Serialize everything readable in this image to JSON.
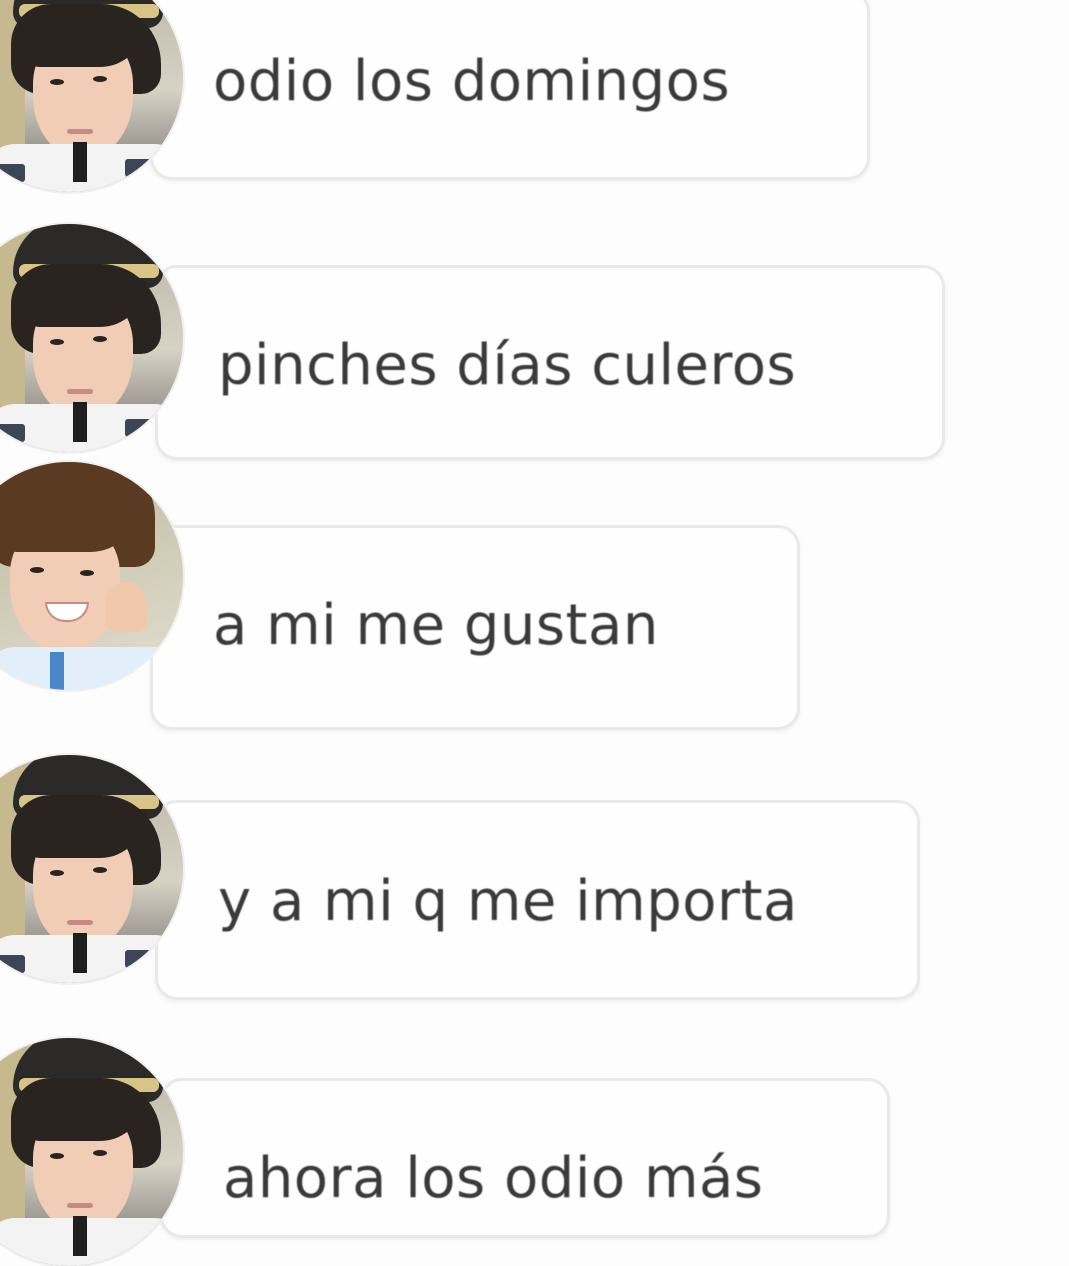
{
  "messages": [
    {
      "text": "odio los domingos"
    },
    {
      "text": "pinches días culeros"
    },
    {
      "text": "a mi me gustan"
    },
    {
      "text": "y a mi q me importa"
    },
    {
      "text": "ahora los odio más"
    }
  ],
  "colors": {
    "background": "#fdfdfd",
    "bubble": "#fefefe",
    "bubble_border": "#e9e9e9",
    "text": "#3a3a3a"
  }
}
